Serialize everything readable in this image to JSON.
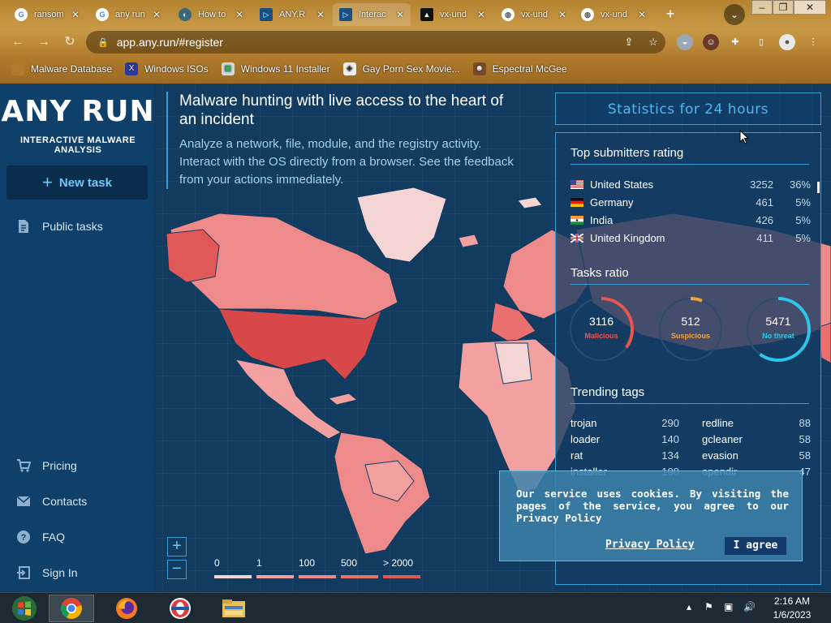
{
  "browser": {
    "tabs": [
      {
        "title": "ransom",
        "icon": "google-icon"
      },
      {
        "title": "any run",
        "icon": "google-icon"
      },
      {
        "title": "How to",
        "icon": "globe-icon"
      },
      {
        "title": "ANY.R",
        "icon": "anyrun-icon"
      },
      {
        "title": "Interac",
        "icon": "anyrun-icon"
      },
      {
        "title": "vx-und",
        "icon": "vx-icon"
      },
      {
        "title": "vx-und",
        "icon": "globe-icon"
      },
      {
        "title": "vx-und",
        "icon": "globe-icon"
      }
    ],
    "url": "app.any.run/#register",
    "bookmarks": [
      {
        "label": "Malware Database",
        "icon": "folder-icon"
      },
      {
        "label": "Windows ISOs",
        "icon": "x-icon"
      },
      {
        "label": "Windows 11 Installer",
        "icon": "image-icon"
      },
      {
        "label": "Gay Porn Sex Movie...",
        "icon": "site-icon"
      },
      {
        "label": "Espectral McGee",
        "icon": "avatar-icon"
      }
    ]
  },
  "sidebar": {
    "logo_left": "ANY",
    "logo_right": "RUN",
    "tagline": "INTERACTIVE MALWARE ANALYSIS",
    "new_task": "New task",
    "nav_top": [
      {
        "label": "Public tasks",
        "icon": "document-icon"
      }
    ],
    "nav_bottom": [
      {
        "label": "Pricing",
        "icon": "cart-icon"
      },
      {
        "label": "Contacts",
        "icon": "mail-icon"
      },
      {
        "label": "FAQ",
        "icon": "help-icon"
      },
      {
        "label": "Sign In",
        "icon": "signin-icon"
      }
    ]
  },
  "hero": {
    "title": "Malware hunting with live access to the heart of an incident",
    "body": "Analyze a network, file, module, and the registry activity. Interact with the OS directly from a browser. See the feedback from your actions immediately."
  },
  "map": {
    "zoom_in": "+",
    "zoom_out": "−",
    "legend": [
      {
        "label": "0",
        "color": "#f4d4d4"
      },
      {
        "label": "1",
        "color": "#f2a0a0"
      },
      {
        "label": "100",
        "color": "#ee8a8a"
      },
      {
        "label": "500",
        "color": "#ea7070"
      },
      {
        "label": "> 2000",
        "color": "#e05858"
      }
    ]
  },
  "stats": {
    "title": "Statistics for 24 hours",
    "submitters_heading": "Top submitters rating",
    "submitters": [
      {
        "country": "United States",
        "count": "3252",
        "pct": "36%",
        "flag": "us"
      },
      {
        "country": "Germany",
        "count": "461",
        "pct": "5%",
        "flag": "de"
      },
      {
        "country": "India",
        "count": "426",
        "pct": "5%",
        "flag": "in"
      },
      {
        "country": "United Kingdom",
        "count": "411",
        "pct": "5%",
        "flag": "gb"
      }
    ],
    "ratio_heading": "Tasks ratio",
    "ratio": [
      {
        "value": "3116",
        "label": "Malicious",
        "color": "#e8554f",
        "fraction": 0.35
      },
      {
        "value": "512",
        "label": "Suspicious",
        "color": "#f0a33a",
        "fraction": 0.06
      },
      {
        "value": "5471",
        "label": "No threat",
        "color": "#2ec5e8",
        "fraction": 0.6
      }
    ],
    "tags_heading": "Trending tags",
    "tags_left": [
      {
        "tag": "trojan",
        "count": "290"
      },
      {
        "tag": "loader",
        "count": "140"
      },
      {
        "tag": "rat",
        "count": "134"
      },
      {
        "tag": "installer",
        "count": "100"
      }
    ],
    "tags_right": [
      {
        "tag": "redline",
        "count": "88"
      },
      {
        "tag": "gcleaner",
        "count": "58"
      },
      {
        "tag": "evasion",
        "count": "58"
      },
      {
        "tag": "opendir",
        "count": "47"
      }
    ]
  },
  "cookie": {
    "message": "Our service uses cookies. By visiting the pages of the service, you agree to our Privacy Policy",
    "policy_link": "Privacy Policy",
    "agree": "I agree"
  },
  "taskbar": {
    "time": "2:16 AM",
    "date": "1/6/2023",
    "apps": [
      "windows-icon",
      "chrome-icon",
      "firefox-icon",
      "opera-icon",
      "explorer-icon"
    ]
  }
}
